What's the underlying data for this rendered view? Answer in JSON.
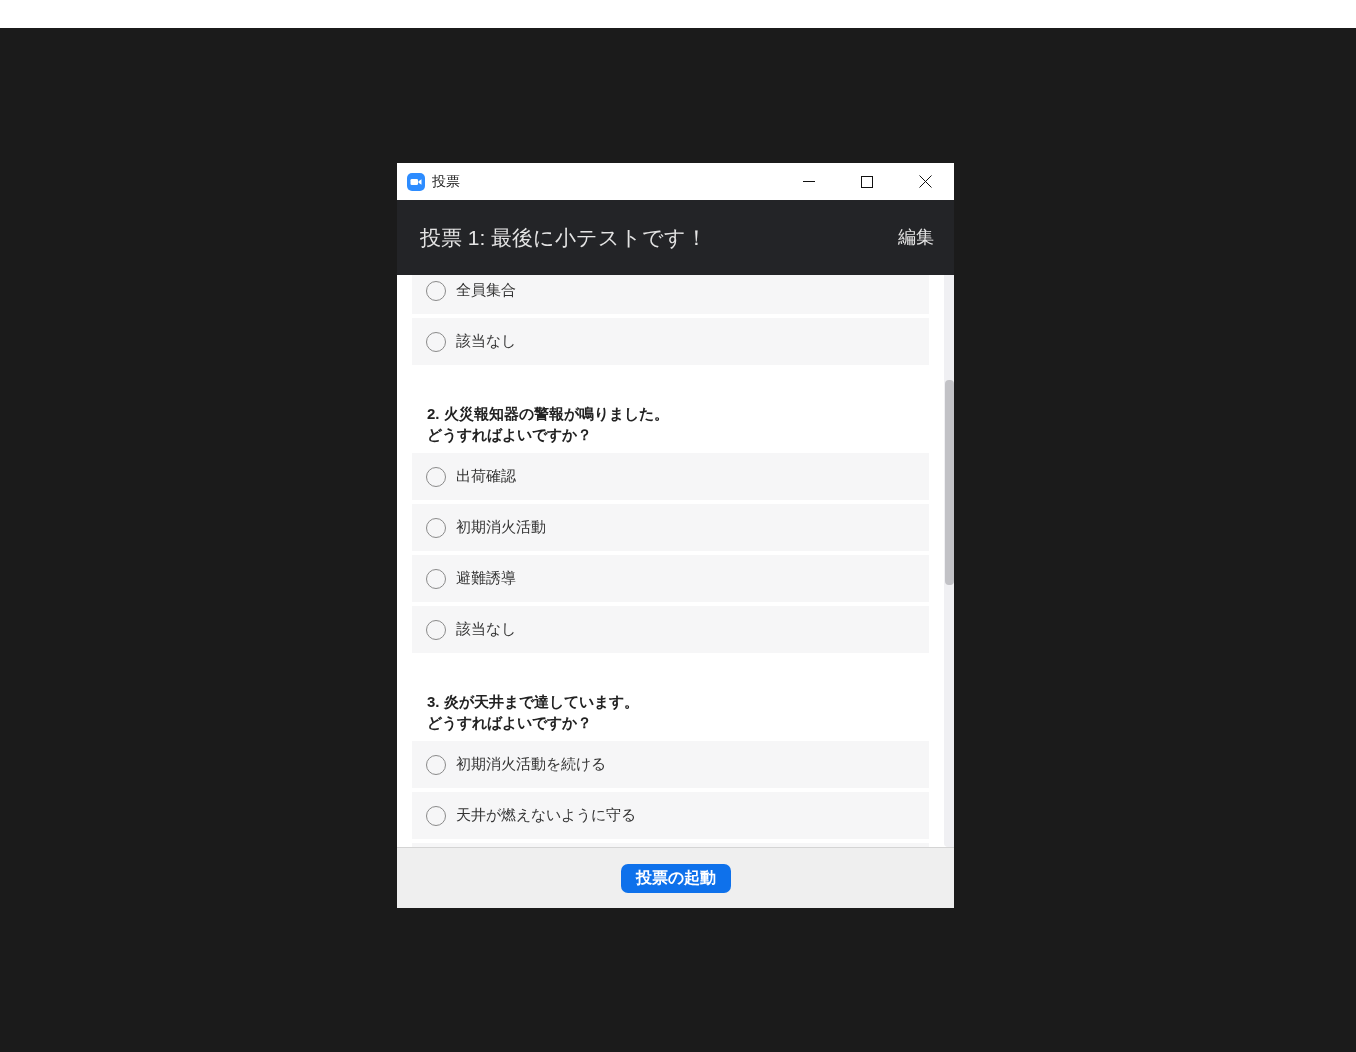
{
  "window": {
    "title": "投票"
  },
  "header": {
    "title": "投票 1: 最後に小テストです！",
    "edit_link": "編集"
  },
  "questions": [
    {
      "options": [
        {
          "label": "全員集合",
          "selected": false
        },
        {
          "label": "該当なし",
          "selected": false
        }
      ]
    },
    {
      "title_lines": [
        "2. 火災報知器の警報が鳴りました。",
        "どうすればよいですか？"
      ],
      "options": [
        {
          "label": "出荷確認",
          "selected": false
        },
        {
          "label": "初期消火活動",
          "selected": false
        },
        {
          "label": "避難誘導",
          "selected": false
        },
        {
          "label": "該当なし",
          "selected": false
        }
      ]
    },
    {
      "title_lines": [
        "3. 炎が天井まで達しています。",
        "どうすればよいですか？"
      ],
      "options": [
        {
          "label": "初期消火活動を続ける",
          "selected": false
        },
        {
          "label": "天井が燃えないように守る",
          "selected": false
        }
      ]
    }
  ],
  "footer": {
    "button": "投票の起動"
  }
}
